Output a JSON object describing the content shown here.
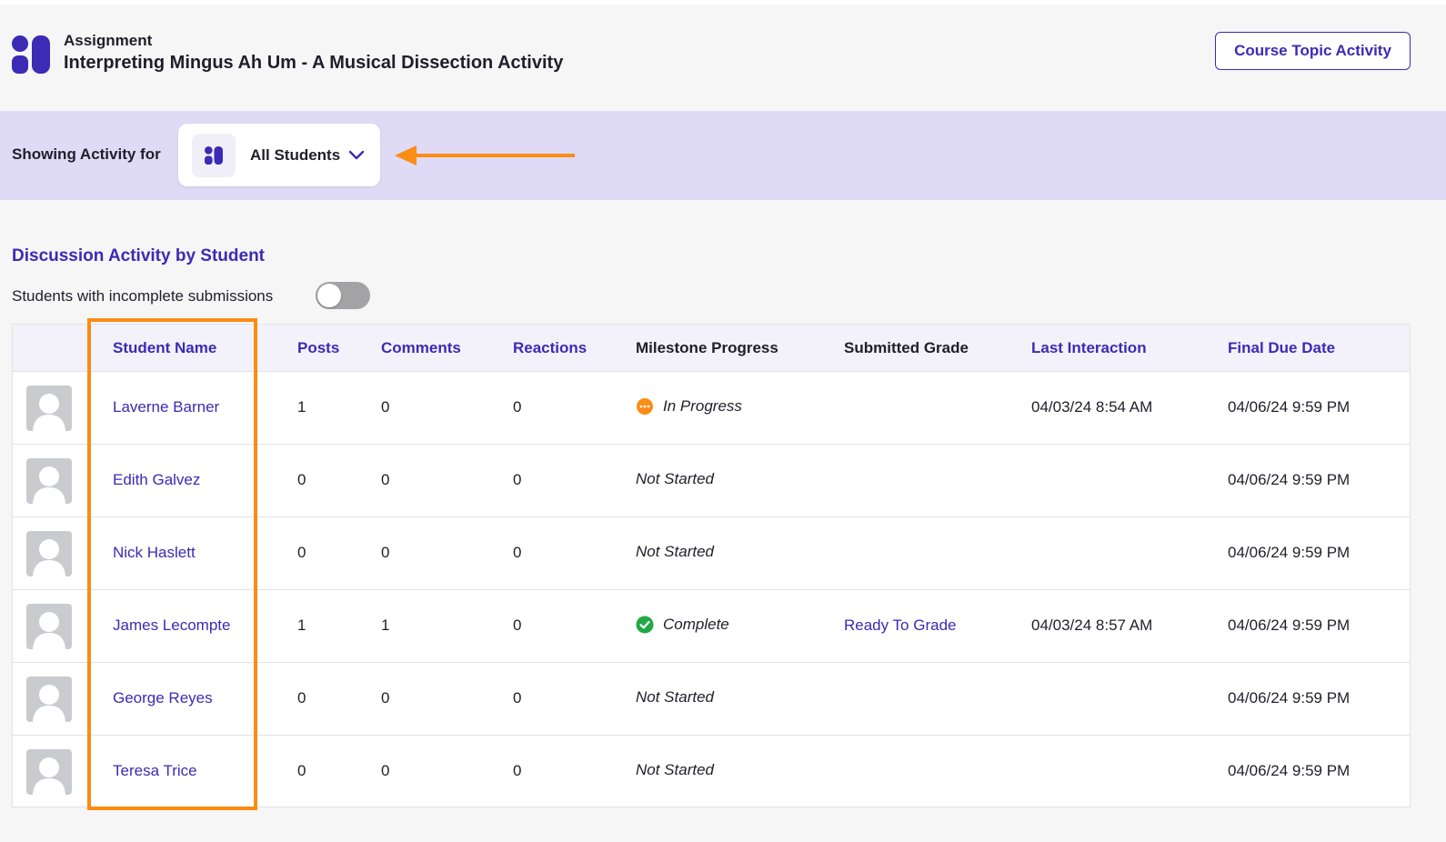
{
  "header": {
    "kicker": "Assignment",
    "title": "Interpreting Mingus Ah Um - A Musical Dissection Activity",
    "course_topic_button": "Course Topic Activity",
    "logo_icon": "brand-logo-icon"
  },
  "filter": {
    "label": "Showing Activity for",
    "selected": "All Students",
    "icon": "group-icon",
    "chevron": "chevron-down-icon",
    "annotation": "arrow-left-icon"
  },
  "section": {
    "title": "Discussion Activity by Student",
    "toggle_label": "Students with incomplete submissions",
    "toggle_on": false
  },
  "table": {
    "columns": {
      "student_name": "Student Name",
      "posts": "Posts",
      "comments": "Comments",
      "reactions": "Reactions",
      "milestone": "Milestone Progress",
      "grade": "Submitted Grade",
      "last": "Last Interaction",
      "due": "Final Due Date"
    },
    "rows": [
      {
        "name": "Laverne Barner",
        "posts": "1",
        "comments": "0",
        "reactions": "0",
        "milestone": "In Progress",
        "milestone_state": "in-progress",
        "grade": "",
        "last": "04/03/24 8:54 AM",
        "due": "04/06/24 9:59 PM"
      },
      {
        "name": "Edith Galvez",
        "posts": "0",
        "comments": "0",
        "reactions": "0",
        "milestone": "Not Started",
        "milestone_state": "not-started",
        "grade": "",
        "last": "",
        "due": "04/06/24 9:59 PM"
      },
      {
        "name": "Nick Haslett",
        "posts": "0",
        "comments": "0",
        "reactions": "0",
        "milestone": "Not Started",
        "milestone_state": "not-started",
        "grade": "",
        "last": "",
        "due": "04/06/24 9:59 PM"
      },
      {
        "name": "James Lecompte",
        "posts": "1",
        "comments": "1",
        "reactions": "0",
        "milestone": "Complete",
        "milestone_state": "complete",
        "grade": "Ready To Grade",
        "last": "04/03/24 8:57 AM",
        "due": "04/06/24 9:59 PM"
      },
      {
        "name": "George Reyes",
        "posts": "0",
        "comments": "0",
        "reactions": "0",
        "milestone": "Not Started",
        "milestone_state": "not-started",
        "grade": "",
        "last": "",
        "due": "04/06/24 9:59 PM"
      },
      {
        "name": "Teresa Trice",
        "posts": "0",
        "comments": "0",
        "reactions": "0",
        "milestone": "Not Started",
        "milestone_state": "not-started",
        "grade": "",
        "last": "",
        "due": "04/06/24 9:59 PM"
      }
    ]
  },
  "colors": {
    "accent": "#3b2bb5",
    "filter_band": "#dfdbf6",
    "annotation": "#fb8c14",
    "in_progress": "#fb8c14",
    "complete": "#22a845"
  }
}
